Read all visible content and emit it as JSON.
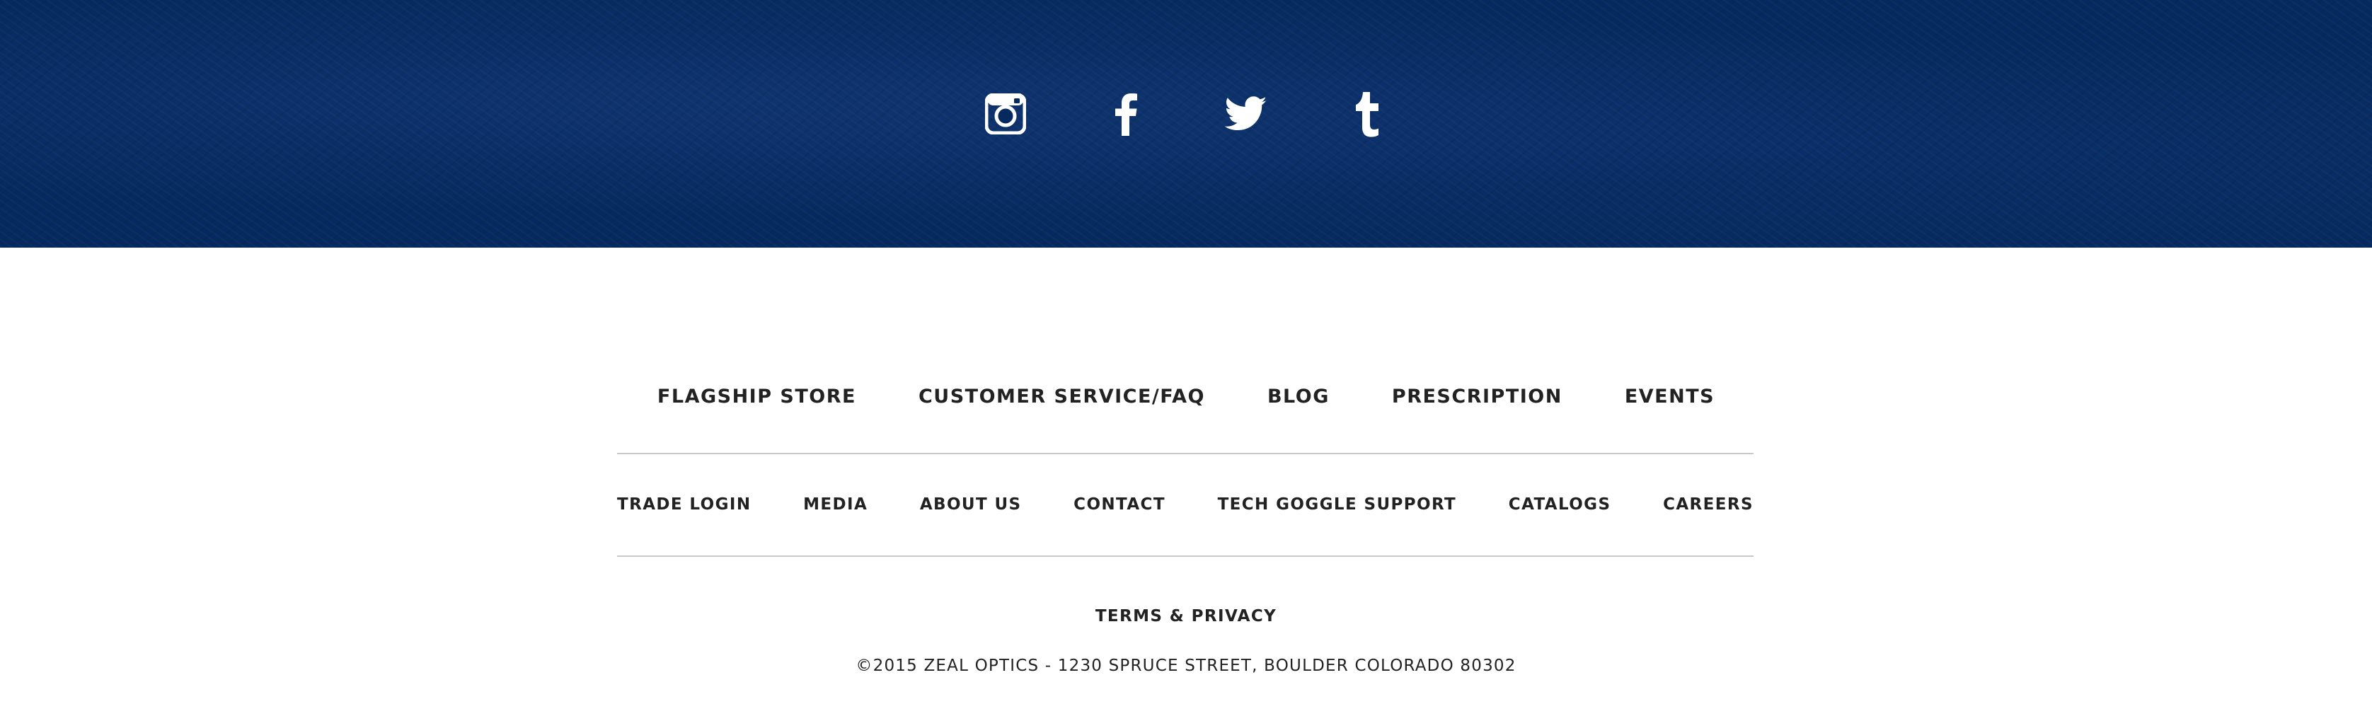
{
  "social": {
    "background_color": "#062a5f",
    "icon_color": "#ffffff",
    "icons": [
      "instagram-icon",
      "facebook-icon",
      "twitter-icon",
      "tumblr-icon"
    ]
  },
  "primary_nav": {
    "items": [
      {
        "label": "FLAGSHIP STORE"
      },
      {
        "label": "CUSTOMER SERVICE/FAQ"
      },
      {
        "label": "BLOG"
      },
      {
        "label": "PRESCRIPTION"
      },
      {
        "label": "EVENTS"
      }
    ]
  },
  "secondary_nav": {
    "items": [
      {
        "label": "TRADE LOGIN"
      },
      {
        "label": "MEDIA"
      },
      {
        "label": "ABOUT US"
      },
      {
        "label": "CONTACT"
      },
      {
        "label": "TECH GOGGLE SUPPORT"
      },
      {
        "label": "CATALOGS"
      },
      {
        "label": "CAREERS"
      }
    ]
  },
  "legal": {
    "terms_label": "TERMS & PRIVACY",
    "copyright": "©2015 ZEAL OPTICS - 1230 SPRUCE STREET, BOULDER COLORADO 80302"
  },
  "colors": {
    "text": "#222222",
    "divider": "#c9c9c9",
    "footer_background": "#ffffff"
  }
}
